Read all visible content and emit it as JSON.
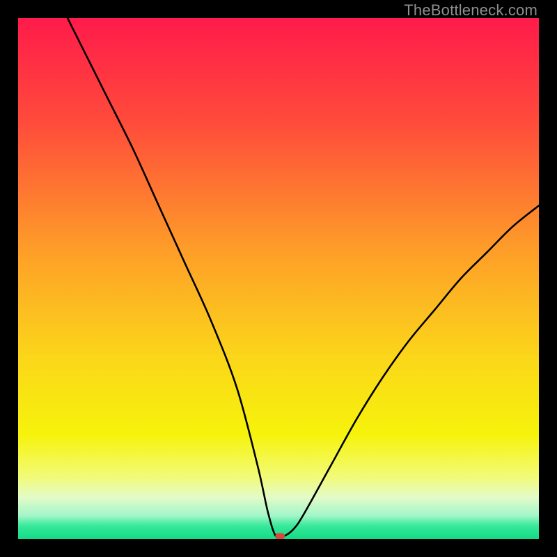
{
  "watermark": "TheBottleneck.com",
  "chart_data": {
    "type": "line",
    "title": "",
    "xlabel": "",
    "ylabel": "",
    "xlim": [
      0,
      100
    ],
    "ylim": [
      0,
      100
    ],
    "grid": false,
    "background_gradient": [
      {
        "stop": 0.0,
        "color": "#ff1b4a"
      },
      {
        "stop": 0.2,
        "color": "#ff4b3b"
      },
      {
        "stop": 0.45,
        "color": "#fe9f28"
      },
      {
        "stop": 0.65,
        "color": "#fbd61a"
      },
      {
        "stop": 0.8,
        "color": "#f6f30b"
      },
      {
        "stop": 0.88,
        "color": "#f2fb76"
      },
      {
        "stop": 0.92,
        "color": "#e3fbc8"
      },
      {
        "stop": 0.955,
        "color": "#a3f6c9"
      },
      {
        "stop": 0.975,
        "color": "#37e99a"
      },
      {
        "stop": 1.0,
        "color": "#12db86"
      }
    ],
    "series": [
      {
        "name": "bottleneck-curve",
        "x": [
          9.5,
          12,
          17,
          22,
          27,
          32,
          37,
          42,
          46,
          48,
          49.5,
          51,
          53,
          55,
          60,
          65,
          70,
          75,
          80,
          85,
          90,
          95,
          100
        ],
        "y": [
          100,
          95,
          85,
          75,
          64,
          53,
          42,
          29,
          14,
          5,
          0.5,
          0.5,
          2,
          5,
          14,
          23,
          31,
          38,
          44,
          50,
          55,
          60,
          64
        ]
      }
    ],
    "marker": {
      "name": "optimal-point",
      "x": 50.3,
      "y": 0.5,
      "color": "#d54a3e"
    }
  }
}
